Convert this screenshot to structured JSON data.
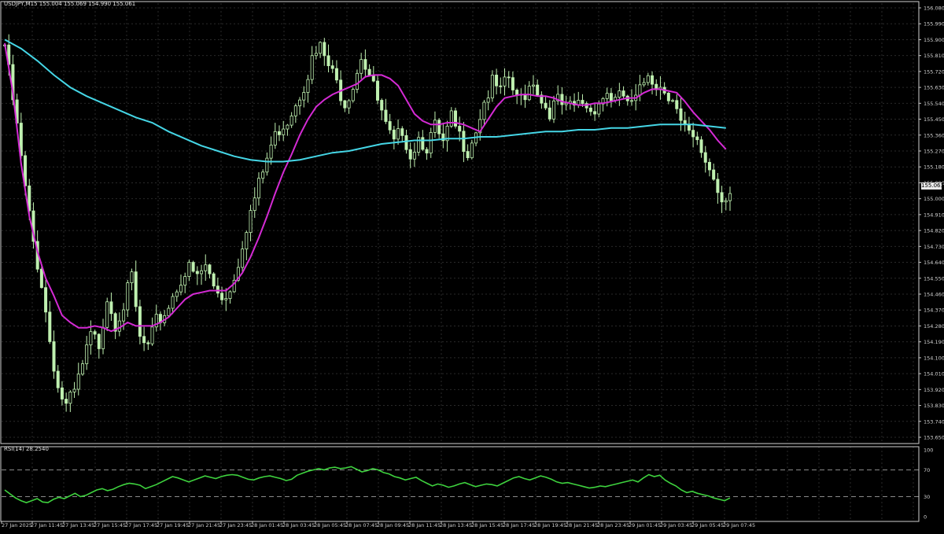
{
  "chart_header": {
    "symbol": "USDJPY,M15",
    "ohlc": "155.004 155.069 154.990 155.061"
  },
  "current_price_label": "155.061",
  "colors": {
    "background": "#000000",
    "grid": "#2a2a2a",
    "candle": "#bff0b0",
    "ma_fast": "#d42ad4",
    "ma_slow": "#45d6e6",
    "rsi_line": "#3ed23e",
    "rsi_level_line": "#8a8a8a",
    "price_label_bg": "#e8e8e8"
  },
  "indicators": {
    "rsi_title": "RSI(14) 28.2540"
  },
  "chart_data": [
    {
      "type": "candlestick",
      "title": "USDJPY,M15",
      "ylim": [
        153.65,
        156.08
      ],
      "y_ticks": [
        "156.080",
        "155.990",
        "155.900",
        "155.810",
        "155.720",
        "155.630",
        "155.540",
        "155.450",
        "155.360",
        "155.270",
        "155.180",
        "155.090",
        "155.000",
        "154.910",
        "154.820",
        "154.730",
        "154.640",
        "154.550",
        "154.460",
        "154.370",
        "154.280",
        "154.190",
        "154.100",
        "154.010",
        "153.920",
        "153.830",
        "153.740",
        "153.650"
      ],
      "x_ticks": [
        "27 Jan 2025",
        "27 Jan 11:45",
        "27 Jan 13:45",
        "27 Jan 15:45",
        "27 Jan 17:45",
        "27 Jan 19:45",
        "27 Jan 21:45",
        "27 Jan 23:45",
        "28 Jan 01:45",
        "28 Jan 03:45",
        "28 Jan 05:45",
        "28 Jan 07:45",
        "28 Jan 09:45",
        "28 Jan 11:45",
        "28 Jan 13:45",
        "28 Jan 15:45",
        "28 Jan 17:45",
        "28 Jan 19:45",
        "28 Jan 21:45",
        "28 Jan 23:45",
        "29 Jan 01:45",
        "29 Jan 03:45",
        "29 Jan 05:45",
        "29 Jan 07:45"
      ],
      "close_path": [
        [
          0,
          155.87
        ],
        [
          3,
          155.4
        ],
        [
          5,
          155.05
        ],
        [
          7,
          154.75
        ],
        [
          9,
          154.52
        ],
        [
          11,
          154.2
        ],
        [
          13,
          153.93
        ],
        [
          15,
          153.82
        ],
        [
          17,
          153.9
        ],
        [
          19,
          154.05
        ],
        [
          21,
          154.22
        ],
        [
          23,
          154.18
        ],
        [
          25,
          154.45
        ],
        [
          27,
          154.3
        ],
        [
          29,
          154.4
        ],
        [
          31,
          154.55
        ],
        [
          33,
          154.2
        ],
        [
          35,
          154.15
        ],
        [
          37,
          154.3
        ],
        [
          39,
          154.35
        ],
        [
          41,
          154.45
        ],
        [
          43,
          154.55
        ],
        [
          45,
          154.6
        ],
        [
          47,
          154.55
        ],
        [
          49,
          154.62
        ],
        [
          51,
          154.5
        ],
        [
          53,
          154.45
        ],
        [
          55,
          154.48
        ],
        [
          57,
          154.65
        ],
        [
          59,
          154.85
        ],
        [
          61,
          155.0
        ],
        [
          63,
          155.15
        ],
        [
          65,
          155.3
        ],
        [
          67,
          155.4
        ],
        [
          69,
          155.45
        ],
        [
          71,
          155.55
        ],
        [
          73,
          155.65
        ],
        [
          75,
          155.78
        ],
        [
          77,
          155.85
        ],
        [
          79,
          155.75
        ],
        [
          81,
          155.65
        ],
        [
          83,
          155.55
        ],
        [
          85,
          155.65
        ],
        [
          87,
          155.82
        ],
        [
          89,
          155.7
        ],
        [
          91,
          155.55
        ],
        [
          93,
          155.4
        ],
        [
          95,
          155.3
        ],
        [
          97,
          155.4
        ],
        [
          99,
          155.25
        ],
        [
          101,
          155.35
        ],
        [
          103,
          155.3
        ],
        [
          105,
          155.4
        ],
        [
          107,
          155.3
        ],
        [
          109,
          155.45
        ],
        [
          111,
          155.35
        ],
        [
          113,
          155.28
        ],
        [
          115,
          155.4
        ],
        [
          117,
          155.55
        ],
        [
          119,
          155.65
        ],
        [
          121,
          155.6
        ],
        [
          123,
          155.68
        ],
        [
          125,
          155.55
        ],
        [
          127,
          155.6
        ],
        [
          129,
          155.68
        ],
        [
          131,
          155.55
        ],
        [
          133,
          155.5
        ],
        [
          135,
          155.55
        ],
        [
          137,
          155.5
        ],
        [
          139,
          155.52
        ],
        [
          141,
          155.55
        ],
        [
          143,
          155.5
        ],
        [
          145,
          155.55
        ],
        [
          147,
          155.6
        ],
        [
          149,
          155.55
        ],
        [
          151,
          155.58
        ],
        [
          153,
          155.52
        ],
        [
          155,
          155.6
        ],
        [
          157,
          155.72
        ],
        [
          159,
          155.65
        ],
        [
          161,
          155.62
        ],
        [
          163,
          155.58
        ],
        [
          165,
          155.42
        ],
        [
          167,
          155.35
        ],
        [
          169,
          155.3
        ],
        [
          171,
          155.22
        ],
        [
          173,
          155.12
        ],
        [
          175,
          155.0
        ],
        [
          177,
          155.06
        ]
      ],
      "series": [
        {
          "name": "",
          "path": [
            [
              0,
              155.88
            ],
            [
              2,
              155.6
            ],
            [
              4,
              155.2
            ],
            [
              6,
              154.9
            ],
            [
              8,
              154.7
            ],
            [
              10,
              154.55
            ],
            [
              12,
              154.45
            ],
            [
              14,
              154.34
            ],
            [
              16,
              154.3
            ],
            [
              18,
              154.27
            ],
            [
              20,
              154.27
            ],
            [
              22,
              154.28
            ],
            [
              24,
              154.27
            ],
            [
              26,
              154.25
            ],
            [
              28,
              154.27
            ],
            [
              30,
              154.3
            ],
            [
              32,
              154.28
            ],
            [
              34,
              154.28
            ],
            [
              36,
              154.28
            ],
            [
              38,
              154.3
            ],
            [
              40,
              154.33
            ],
            [
              42,
              154.38
            ],
            [
              44,
              154.43
            ],
            [
              46,
              154.46
            ],
            [
              48,
              154.47
            ],
            [
              50,
              154.48
            ],
            [
              52,
              154.48
            ],
            [
              54,
              154.48
            ],
            [
              56,
              154.52
            ],
            [
              58,
              154.58
            ],
            [
              60,
              154.67
            ],
            [
              62,
              154.78
            ],
            [
              64,
              154.9
            ],
            [
              66,
              155.03
            ],
            [
              68,
              155.15
            ],
            [
              70,
              155.25
            ],
            [
              72,
              155.36
            ],
            [
              74,
              155.45
            ],
            [
              76,
              155.52
            ],
            [
              78,
              155.56
            ],
            [
              80,
              155.59
            ],
            [
              82,
              155.61
            ],
            [
              84,
              155.63
            ],
            [
              86,
              155.65
            ],
            [
              88,
              155.69
            ],
            [
              90,
              155.7
            ],
            [
              92,
              155.7
            ],
            [
              94,
              155.68
            ],
            [
              96,
              155.64
            ],
            [
              98,
              155.56
            ],
            [
              100,
              155.48
            ],
            [
              102,
              155.44
            ],
            [
              104,
              155.42
            ],
            [
              106,
              155.42
            ],
            [
              108,
              155.43
            ],
            [
              110,
              155.43
            ],
            [
              112,
              155.42
            ],
            [
              114,
              155.4
            ],
            [
              116,
              155.38
            ],
            [
              118,
              155.45
            ],
            [
              120,
              155.52
            ],
            [
              122,
              155.57
            ],
            [
              124,
              155.58
            ],
            [
              126,
              155.59
            ],
            [
              128,
              155.59
            ],
            [
              130,
              155.58
            ],
            [
              132,
              155.58
            ],
            [
              134,
              155.57
            ],
            [
              136,
              155.55
            ],
            [
              138,
              155.54
            ],
            [
              140,
              155.53
            ],
            [
              142,
              155.53
            ],
            [
              144,
              155.54
            ],
            [
              146,
              155.54
            ],
            [
              148,
              155.55
            ],
            [
              150,
              155.56
            ],
            [
              152,
              155.57
            ],
            [
              154,
              155.57
            ],
            [
              156,
              155.6
            ],
            [
              158,
              155.62
            ],
            [
              160,
              155.62
            ],
            [
              162,
              155.61
            ],
            [
              164,
              155.6
            ],
            [
              166,
              155.55
            ],
            [
              168,
              155.49
            ],
            [
              170,
              155.44
            ],
            [
              172,
              155.39
            ],
            [
              174,
              155.33
            ],
            [
              176,
              155.28
            ]
          ]
        },
        {
          "name": "",
          "path": [
            [
              0,
              155.9
            ],
            [
              4,
              155.85
            ],
            [
              8,
              155.78
            ],
            [
              12,
              155.7
            ],
            [
              16,
              155.63
            ],
            [
              20,
              155.58
            ],
            [
              24,
              155.54
            ],
            [
              28,
              155.5
            ],
            [
              32,
              155.46
            ],
            [
              36,
              155.43
            ],
            [
              40,
              155.38
            ],
            [
              44,
              155.34
            ],
            [
              48,
              155.3
            ],
            [
              52,
              155.27
            ],
            [
              56,
              155.24
            ],
            [
              60,
              155.22
            ],
            [
              64,
              155.21
            ],
            [
              68,
              155.21
            ],
            [
              72,
              155.22
            ],
            [
              76,
              155.24
            ],
            [
              80,
              155.26
            ],
            [
              84,
              155.27
            ],
            [
              88,
              155.29
            ],
            [
              92,
              155.31
            ],
            [
              96,
              155.32
            ],
            [
              100,
              155.33
            ],
            [
              104,
              155.33
            ],
            [
              108,
              155.34
            ],
            [
              112,
              155.34
            ],
            [
              116,
              155.35
            ],
            [
              120,
              155.35
            ],
            [
              124,
              155.36
            ],
            [
              128,
              155.37
            ],
            [
              132,
              155.38
            ],
            [
              136,
              155.38
            ],
            [
              140,
              155.39
            ],
            [
              144,
              155.39
            ],
            [
              148,
              155.4
            ],
            [
              152,
              155.4
            ],
            [
              156,
              155.41
            ],
            [
              160,
              155.42
            ],
            [
              164,
              155.42
            ],
            [
              168,
              155.42
            ],
            [
              172,
              155.41
            ],
            [
              176,
              155.4
            ]
          ]
        }
      ]
    },
    {
      "type": "line",
      "title": "RSI(14) 28.2540",
      "ylim": [
        0,
        100
      ],
      "y_ticks": [
        "100",
        "70",
        "30",
        "0"
      ],
      "levels": [
        70,
        30
      ],
      "series": [
        {
          "name": "RSI(14)",
          "values": [
            40,
            34,
            28,
            24,
            21,
            24,
            27,
            22,
            21,
            26,
            29,
            27,
            31,
            35,
            30,
            32,
            36,
            40,
            42,
            39,
            41,
            45,
            48,
            50,
            49,
            47,
            42,
            45,
            48,
            52,
            56,
            60,
            58,
            55,
            52,
            55,
            58,
            61,
            59,
            57,
            60,
            62,
            63,
            62,
            59,
            56,
            55,
            58,
            60,
            61,
            59,
            57,
            54,
            56,
            62,
            65,
            68,
            70,
            72,
            70,
            73,
            74,
            72,
            73,
            75,
            71,
            67,
            69,
            72,
            70,
            66,
            64,
            60,
            58,
            55,
            57,
            59,
            54,
            50,
            46,
            49,
            47,
            44,
            46,
            49,
            51,
            48,
            45,
            47,
            49,
            48,
            46,
            50,
            54,
            58,
            60,
            57,
            55,
            58,
            61,
            59,
            56,
            52,
            50,
            51,
            49,
            47,
            45,
            43,
            44,
            46,
            45,
            47,
            49,
            51,
            53,
            55,
            52,
            58,
            63,
            60,
            62,
            55,
            50,
            46,
            40,
            36,
            38,
            35,
            33,
            31,
            28,
            26,
            24,
            28
          ]
        }
      ]
    }
  ]
}
